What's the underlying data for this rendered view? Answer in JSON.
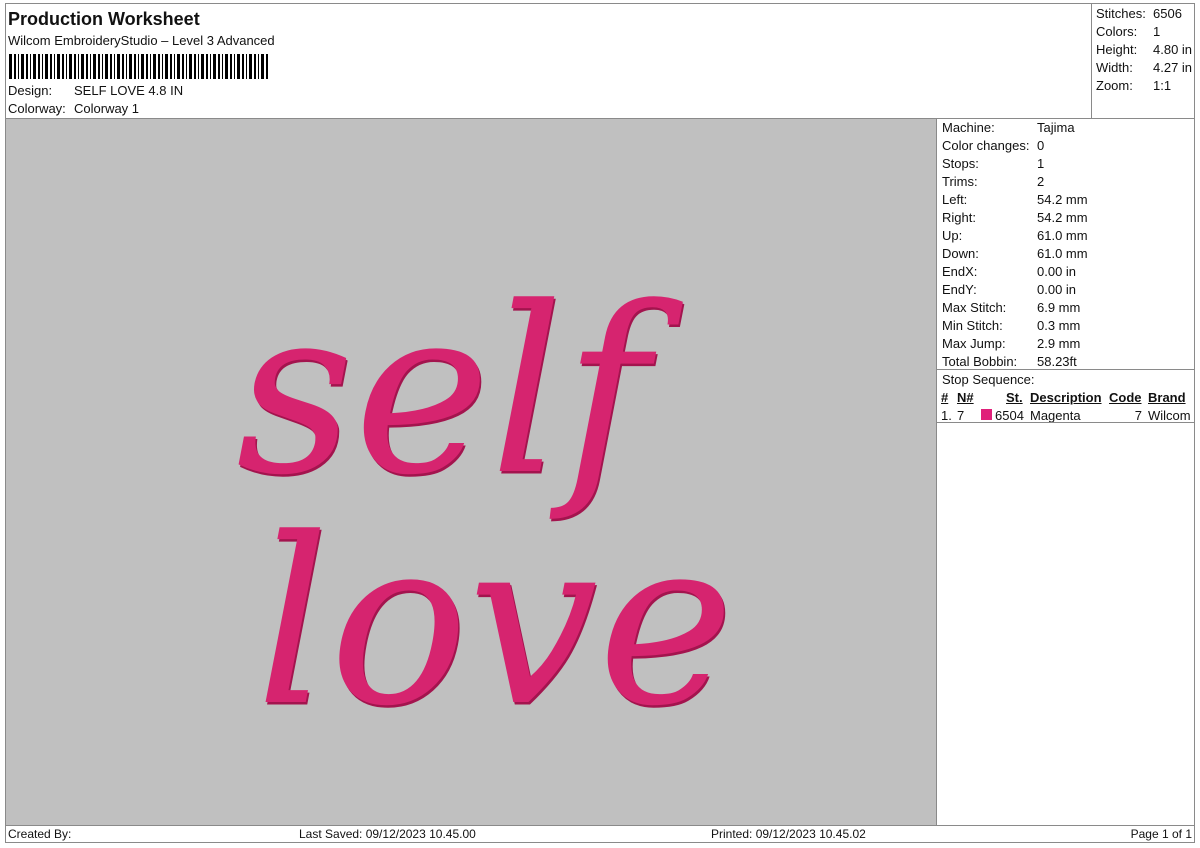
{
  "header": {
    "title": "Production Worksheet",
    "subtitle": "Wilcom EmbroideryStudio – Level 3 Advanced",
    "design_label": "Design:",
    "design_value": "SELF LOVE 4.8 IN",
    "colorway_label": "Colorway:",
    "colorway_value": "Colorway 1"
  },
  "summary": {
    "stitches_label": "Stitches:",
    "stitches_value": "6506",
    "colors_label": "Colors:",
    "colors_value": "1",
    "height_label": "Height:",
    "height_value": "4.80 in",
    "width_label": "Width:",
    "width_value": "4.27 in",
    "zoom_label": "Zoom:",
    "zoom_value": "1:1"
  },
  "details": [
    {
      "label": "Machine:",
      "value": "Tajima"
    },
    {
      "label": "Color changes:",
      "value": "0"
    },
    {
      "label": "Stops:",
      "value": "1"
    },
    {
      "label": "Trims:",
      "value": "2"
    },
    {
      "label": "Left:",
      "value": "54.2 mm"
    },
    {
      "label": "Right:",
      "value": "54.2 mm"
    },
    {
      "label": "Up:",
      "value": "61.0 mm"
    },
    {
      "label": "Down:",
      "value": "61.0 mm"
    },
    {
      "label": "EndX:",
      "value": "0.00 in"
    },
    {
      "label": "EndY:",
      "value": "0.00 in"
    },
    {
      "label": "Max Stitch:",
      "value": "6.9 mm"
    },
    {
      "label": "Min Stitch:",
      "value": "0.3 mm"
    },
    {
      "label": "Max Jump:",
      "value": "2.9 mm"
    },
    {
      "label": "Total Bobbin:",
      "value": "58.23ft"
    }
  ],
  "stop_sequence": {
    "title": "Stop Sequence:",
    "columns": [
      "#",
      "N#",
      "St.",
      "Description",
      "Code",
      "Brand"
    ],
    "rows": [
      {
        "num": "1.",
        "n": "7",
        "swatch_color": "#e0207a",
        "st": "6504",
        "description": "Magenta",
        "code": "7",
        "brand": "Wilcom"
      }
    ]
  },
  "design_preview": {
    "text_line1": "self",
    "text_line2": "love",
    "thread_color": "#d6246f",
    "thread_shadow": "#a3144e",
    "background_color": "#c0c0c0"
  },
  "footer": {
    "created_by": "Created By:",
    "last_saved": "Last Saved: 09/12/2023 10.45.00",
    "printed": "Printed: 09/12/2023 10.45.02",
    "page": "Page 1 of 1"
  }
}
